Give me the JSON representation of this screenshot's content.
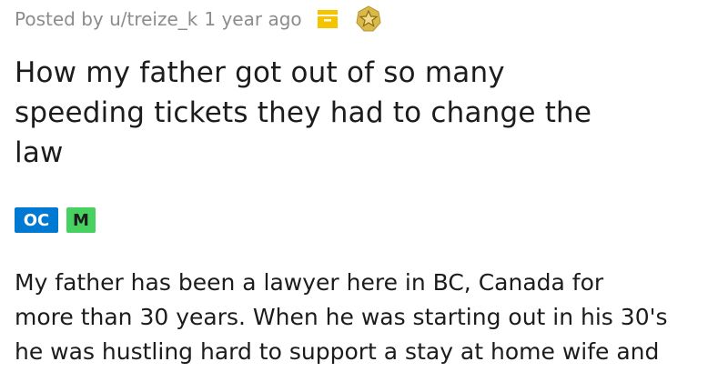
{
  "post": {
    "posted_by": "Posted by u/treize_k",
    "time": "1 year ago",
    "icons": {
      "archive": "archive-icon",
      "award": "award-icon"
    },
    "title_lines": [
      "How my father got out of so many",
      "speeding tickets they had to change the",
      "law"
    ],
    "flairs": [
      {
        "label": "OC",
        "color": "#0079d3"
      },
      {
        "label": "M",
        "color": "#46d160"
      }
    ],
    "body_lines": [
      "My father has been a lawyer here in BC, Canada for",
      "more than 30 years. When he was starting out in his 30's",
      "he was hustling hard to support a stay at home wife and"
    ]
  },
  "colors": {
    "meta_text": "#8a8c8e",
    "text": "#1c1c1c",
    "archive_icon": "#f5c400",
    "award_icon": "#d9b94a"
  }
}
